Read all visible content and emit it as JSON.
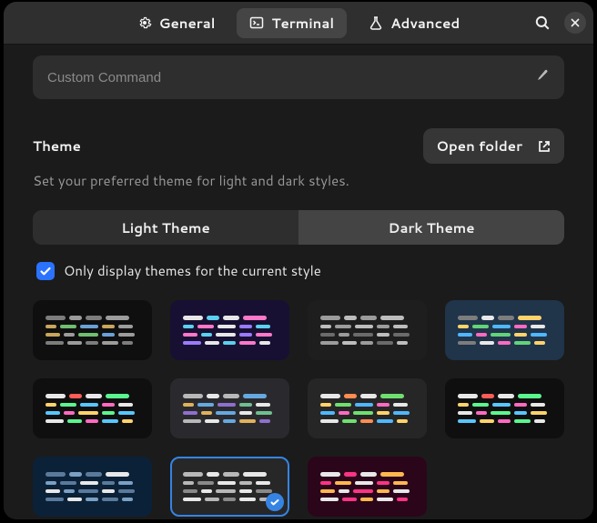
{
  "tabs": {
    "general": "General",
    "terminal": "Terminal",
    "advanced": "Advanced",
    "active": "terminal"
  },
  "custom_command": {
    "placeholder": "Custom Command",
    "value": ""
  },
  "theme_section": {
    "title": "Theme",
    "description": "Set your preferred theme for light and dark styles.",
    "open_folder": "Open folder"
  },
  "segmented": {
    "light": "Light Theme",
    "dark": "Dark Theme",
    "active": "dark"
  },
  "filter": {
    "label": "Only display themes for the current style",
    "checked": true
  },
  "themes": [
    {
      "bg": "#0f0f0f",
      "selected": false
    },
    {
      "bg": "#171032",
      "selected": false
    },
    {
      "bg": "#1e1e1e",
      "selected": false
    },
    {
      "bg": "#20344a",
      "selected": false
    },
    {
      "bg": "#0f0f0f",
      "selected": false
    },
    {
      "bg": "#2a2a2e",
      "selected": false
    },
    {
      "bg": "#262626",
      "selected": false
    },
    {
      "bg": "#0f0f0f",
      "selected": false
    },
    {
      "bg": "#0b2138",
      "selected": false
    },
    {
      "bg": "#272727",
      "selected": true
    },
    {
      "bg": "#2b0519",
      "selected": false
    }
  ],
  "palettes": [
    [
      [
        "#7d7d7d",
        "#9c9c9c",
        "#7d7d7d",
        "#9c9c9c"
      ],
      [
        "#c9a65a",
        "#6fbf6f",
        "#6aa0d8",
        "#c9a65a",
        "#9c9c9c"
      ],
      [
        "#c9a65a",
        "#9c9c9c",
        "#6fbf6f",
        "#6aa0d8",
        "#9c9c9c"
      ],
      [
        "#7d7d7d",
        "#9c9c9c",
        "#7d7d7d",
        "#9c9c9c",
        "#7d7d7d"
      ]
    ],
    [
      [
        "#e7e7e7",
        "#5bd0f0",
        "#e7e7e7",
        "#ff77c8"
      ],
      [
        "#5bd0f0",
        "#ff77c8",
        "#e7e7e7",
        "#9a7bff",
        "#5bd0f0"
      ],
      [
        "#ff77c8",
        "#5bd0f0",
        "#e7e7e7",
        "#9a7bff",
        "#ff77c8"
      ],
      [
        "#9a7bff",
        "#e7e7e7",
        "#5bd0f0",
        "#ff77c8",
        "#e7e7e7"
      ]
    ],
    [
      [
        "#9c9c9c",
        "#bdbdbd",
        "#9c9c9c",
        "#bdbdbd"
      ],
      [
        "#bdbdbd",
        "#9c9c9c",
        "#bdbdbd",
        "#9c9c9c",
        "#bdbdbd"
      ],
      [
        "#6b6b6b",
        "#9c9c9c",
        "#6b6b6b",
        "#bdbdbd",
        "#6b6b6b"
      ],
      [
        "#9c9c9c",
        "#bdbdbd",
        "#9c9c9c",
        "#6b6b6b",
        "#bdbdbd"
      ]
    ],
    [
      [
        "#7d7d7d",
        "#e8e8e8",
        "#7d7d7d",
        "#ffd36a"
      ],
      [
        "#ffd36a",
        "#62d37a",
        "#4fb7ff",
        "#ff6ac1",
        "#e8e8e8"
      ],
      [
        "#4fb7ff",
        "#ff6ac1",
        "#62d37a",
        "#ffd36a",
        "#4fb7ff"
      ],
      [
        "#7d7d7d",
        "#e8e8e8",
        "#ff6ac1",
        "#62d37a",
        "#ffd36a"
      ]
    ],
    [
      [
        "#e8e8e8",
        "#ff5c57",
        "#e8e8e8",
        "#5af78e"
      ],
      [
        "#ffd36a",
        "#5af78e",
        "#57c7ff",
        "#ff6ac1",
        "#e8e8e8"
      ],
      [
        "#57c7ff",
        "#ff6ac1",
        "#ffd36a",
        "#5af78e",
        "#57c7ff"
      ],
      [
        "#e8e8e8",
        "#5af78e",
        "#ff6ac1",
        "#57c7ff",
        "#ffd36a"
      ]
    ],
    [
      [
        "#b8b8b8",
        "#e8e8e8",
        "#b8b8b8",
        "#65a9e0"
      ],
      [
        "#e0b15a",
        "#65a9e0",
        "#8f6fce",
        "#6fbf8f",
        "#e8e8e8"
      ],
      [
        "#8f6fce",
        "#e0b15a",
        "#65a9e0",
        "#e8e8e8",
        "#6fbf8f"
      ],
      [
        "#b8b8b8",
        "#e8e8e8",
        "#65a9e0",
        "#e0b15a",
        "#8f6fce"
      ]
    ],
    [
      [
        "#e8e8e8",
        "#ff8c52",
        "#e8e8e8",
        "#6fe06f"
      ],
      [
        "#ffd36a",
        "#6fe06f",
        "#4fb7ff",
        "#ff6ac1",
        "#e8e8e8"
      ],
      [
        "#4fb7ff",
        "#ff6ac1",
        "#6fe06f",
        "#ffd36a",
        "#4fb7ff"
      ],
      [
        "#e8e8e8",
        "#6fe06f",
        "#ff8c52",
        "#4fb7ff",
        "#ffd36a"
      ]
    ],
    [
      [
        "#e8e8e8",
        "#ff5c57",
        "#e8e8e8",
        "#5af78e"
      ],
      [
        "#ffd36a",
        "#5af78e",
        "#57c7ff",
        "#ff6ac1",
        "#e8e8e8"
      ],
      [
        "#e8e8e8",
        "#ff6ac1",
        "#5af78e",
        "#57c7ff",
        "#ffd36a"
      ],
      [
        "#57c7ff",
        "#ffd36a",
        "#ff6ac1",
        "#5af78e",
        "#e8e8e8"
      ]
    ],
    [
      [
        "#5a7a9c",
        "#7aa0c4",
        "#5a7a9c",
        "#e8e8e8"
      ],
      [
        "#7aa0c4",
        "#5a7a9c",
        "#e8e8e8",
        "#5a7a9c",
        "#7aa0c4"
      ],
      [
        "#e8e8e8",
        "#7aa0c4",
        "#5a7a9c",
        "#e8e8e8",
        "#5a7a9c"
      ],
      [
        "#5a7a9c",
        "#e8e8e8",
        "#7aa0c4",
        "#5a7a9c",
        "#7aa0c4"
      ]
    ],
    [
      [
        "#b8b8b8",
        "#e8e8e8",
        "#b8b8b8",
        "#e8e8e8"
      ],
      [
        "#b8b8b8",
        "#8a8a8a",
        "#e8e8e8",
        "#b8b8b8",
        "#e8e8e8"
      ],
      [
        "#8a8a8a",
        "#e8e8e8",
        "#b8b8b8",
        "#e8e8e8",
        "#8a8a8a"
      ],
      [
        "#e8e8e8",
        "#b8b8b8",
        "#8a8a8a",
        "#e8e8e8",
        "#b8b8b8"
      ]
    ],
    [
      [
        "#e8e8e8",
        "#ff3385",
        "#e8e8e8",
        "#ffb84d"
      ],
      [
        "#ff3385",
        "#ffb84d",
        "#e8e8e8",
        "#ff3385",
        "#ffb84d"
      ],
      [
        "#ffb84d",
        "#e8e8e8",
        "#ff3385",
        "#ffb84d",
        "#e8e8e8"
      ],
      [
        "#e8e8e8",
        "#ff3385",
        "#ffb84d",
        "#e8e8e8",
        "#ff3385"
      ]
    ]
  ]
}
